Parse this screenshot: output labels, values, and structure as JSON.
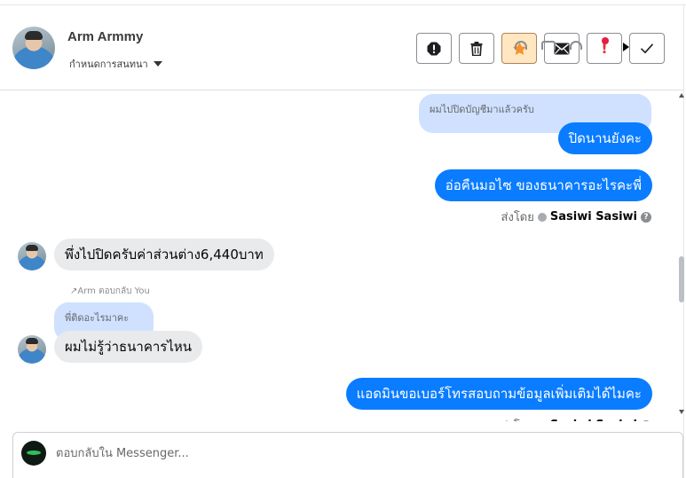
{
  "contact": {
    "name": "Arm Armmy",
    "assign_label": "กำหนดการสนทนา"
  },
  "actions": [
    {
      "name": "spam-report-icon"
    },
    {
      "name": "trash-icon"
    },
    {
      "name": "star-icon"
    },
    {
      "name": "envelope-icon"
    },
    {
      "name": "exclamation-icon",
      "glyph": "!"
    },
    {
      "name": "checkmark-icon"
    }
  ],
  "messages": {
    "quote_1": "ผมไปปิดบัญชีมาแล้วครับ",
    "out_1": "ปิดนานยังคะ",
    "out_2": "อ่อคืนมอไซ ของธนาคารอะไรคะพี่",
    "sent_by_label": "ส่งโดย",
    "sent_by_name": "Sasiwi Sasiwi",
    "help_glyph": "?",
    "in_1": "พึ่งไปปิดครับค่าส่วนต่าง6,440บาท",
    "reply_note": "↗Arm ตอบกลับ You",
    "quote_2": "พี่ติดอะไรมาคะ",
    "in_2": "ผมไม่รู้ว่าธนาคารไหน",
    "out_3": "แอดมินขอเบอร์โทรสอบถามข้อมูลเพิ่มเติมได้ไมคะ"
  },
  "composer": {
    "placeholder": "ตอบกลับใน Messenger..."
  },
  "colors": {
    "outgoing_bubble": "#0a7cff",
    "incoming_bubble": "#e9eaec",
    "quote_bubble": "#cfe1ff",
    "star_accent": "#f5922b",
    "alert_red": "#e4323a"
  }
}
